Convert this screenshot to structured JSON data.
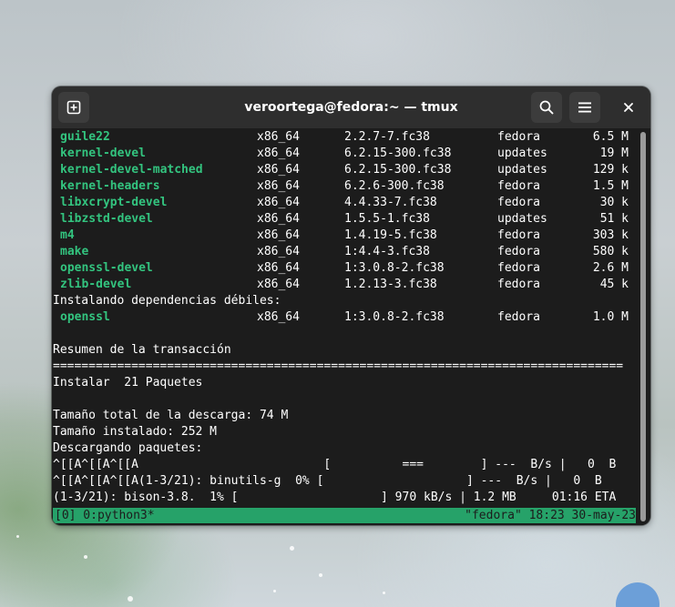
{
  "window": {
    "title": "veroortega@fedora:~ — tmux",
    "icons": {
      "new_tab": "new-tab-icon",
      "search": "search-icon",
      "menu": "hamburger-menu-icon",
      "close": "close-icon"
    }
  },
  "terminal": {
    "packages": [
      {
        "name": "guile22",
        "arch": "x86_64",
        "version": "2.2.7-7.fc38",
        "repo": "fedora",
        "size": "6.5 M"
      },
      {
        "name": "kernel-devel",
        "arch": "x86_64",
        "version": "6.2.15-300.fc38",
        "repo": "updates",
        "size": "19 M"
      },
      {
        "name": "kernel-devel-matched",
        "arch": "x86_64",
        "version": "6.2.15-300.fc38",
        "repo": "updates",
        "size": "129 k"
      },
      {
        "name": "kernel-headers",
        "arch": "x86_64",
        "version": "6.2.6-300.fc38",
        "repo": "fedora",
        "size": "1.5 M"
      },
      {
        "name": "libxcrypt-devel",
        "arch": "x86_64",
        "version": "4.4.33-7.fc38",
        "repo": "fedora",
        "size": "30 k"
      },
      {
        "name": "libzstd-devel",
        "arch": "x86_64",
        "version": "1.5.5-1.fc38",
        "repo": "updates",
        "size": "51 k"
      },
      {
        "name": "m4",
        "arch": "x86_64",
        "version": "1.4.19-5.fc38",
        "repo": "fedora",
        "size": "303 k"
      },
      {
        "name": "make",
        "arch": "x86_64",
        "version": "1:4.4-3.fc38",
        "repo": "fedora",
        "size": "580 k"
      },
      {
        "name": "openssl-devel",
        "arch": "x86_64",
        "version": "1:3.0.8-2.fc38",
        "repo": "fedora",
        "size": "2.6 M"
      },
      {
        "name": "zlib-devel",
        "arch": "x86_64",
        "version": "1.2.13-3.fc38",
        "repo": "fedora",
        "size": "45 k"
      }
    ],
    "weak_deps_header": "Instalando dependencias débiles:",
    "weak_deps": [
      {
        "name": "openssl",
        "arch": "x86_64",
        "version": "1:3.0.8-2.fc38",
        "repo": "fedora",
        "size": "1.0 M"
      }
    ],
    "summary_header": "Resumen de la transacción",
    "separator": "================================================================================",
    "install_line": "Instalar  21 Paquetes",
    "download_size": "Tamaño total de la descarga: 74 M",
    "installed_size": "Tamaño instalado: 252 M",
    "downloading": "Descargando paquetes:",
    "progress_lines": [
      "^[[A^[[A^[[A                          [          ===        ] ---  B/s |   0  B",
      "^[[A^[[A^[[A(1-3/21): binutils-g  0% [                    ] ---  B/s |   0  B",
      "(1-3/21): bison-3.8.  1% [                    ] 970 kB/s | 1.2 MB     01:16 ETA"
    ]
  },
  "tmux_status": {
    "left": "[0] 0:python3*",
    "right": "\"fedora\" 18:23 30-may-23"
  }
}
